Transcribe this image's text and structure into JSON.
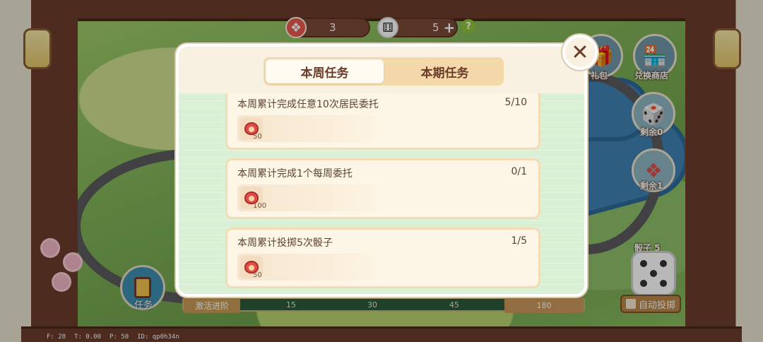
{
  "resources": {
    "bag_count": "3",
    "dice_count": "5",
    "add_symbol": "+",
    "help_symbol": "?"
  },
  "side_buttons": {
    "gift_label": "礼包",
    "shop_label": "兑换商店",
    "remaining_0": "剩余0",
    "remaining_1": "剩余1",
    "dice_label": "骰子 5",
    "auto_roll": "自动投掷"
  },
  "task_button": {
    "label": "任务"
  },
  "progress_bar": {
    "activate_label": "激活进阶",
    "ticks": [
      "15",
      "30",
      "45"
    ],
    "end_value": "180"
  },
  "debug": {
    "fps": "F: 28",
    "time": "T: 0.00",
    "p": "P: 50",
    "id": "ID: qp0h34n"
  },
  "modal": {
    "tabs": [
      {
        "label": "本周任务",
        "active": true
      },
      {
        "label": "本期任务",
        "active": false
      }
    ],
    "close_symbol": "✕",
    "tasks": [
      {
        "title": "本周累计完成任意10次居民委托",
        "progress": "5/10",
        "reward_amount": "50"
      },
      {
        "title": "本周累计完成1个每周委托",
        "progress": "0/1",
        "reward_amount": "100"
      },
      {
        "title": "本周累计投掷5次骰子",
        "progress": "1/5",
        "reward_amount": "50"
      }
    ]
  },
  "colors": {
    "frame_brown": "#6b3c2a",
    "modal_bg": "#f8f0e1",
    "list_green": "#d9f0d4",
    "reward_red": "#e14b48"
  }
}
